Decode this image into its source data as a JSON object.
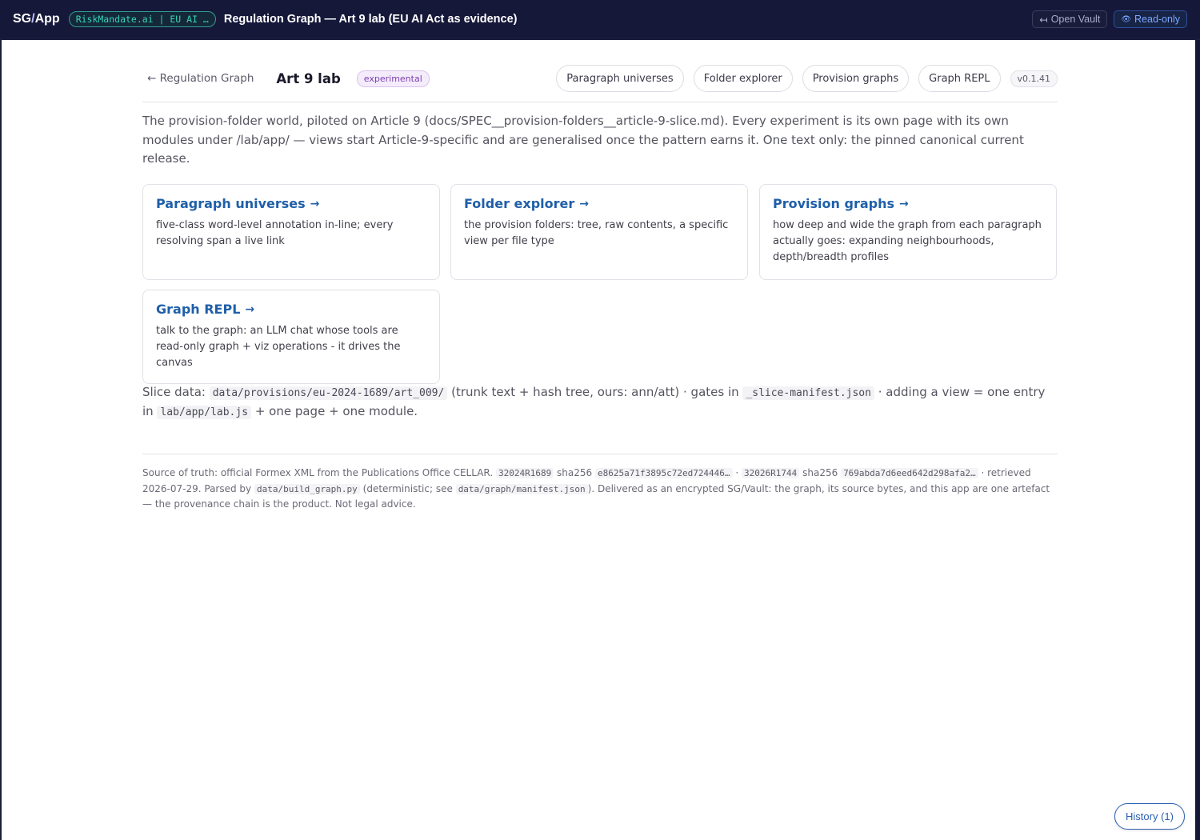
{
  "topbar": {
    "brand_prefix": "SG",
    "brand_slash": "/",
    "brand_suffix": "App",
    "tenant": "RiskMandate.ai | EU AI …",
    "window_title": "Regulation Graph — Art 9 lab (EU AI Act as evidence)",
    "open_vault_icon": "↤",
    "open_vault_label": "Open Vault",
    "read_only_icon": "👁",
    "read_only_label": "Read-only"
  },
  "header": {
    "back_arrow": "←",
    "back_label": "Regulation Graph",
    "title": "Art 9 lab",
    "badge": "experimental",
    "nav": [
      "Paragraph universes",
      "Folder explorer",
      "Provision graphs",
      "Graph REPL"
    ],
    "version": "v0.1.41"
  },
  "intro": "The provision-folder world, piloted on Article 9 (docs/SPEC__provision-folders__article-9-slice.md). Every experiment is its own page with its own modules under /lab/app/ — views start Article-9-specific and are generalised once the pattern earns it. One text only: the pinned canonical current release.",
  "cards": [
    {
      "title": "Paragraph universes",
      "arrow": "→",
      "desc": "five-class word-level annotation in-line; every resolving span a live link"
    },
    {
      "title": "Folder explorer",
      "arrow": "→",
      "desc": "the provision folders: tree, raw contents, a specific view per file type"
    },
    {
      "title": "Provision graphs",
      "arrow": "→",
      "desc": "how deep and wide the graph from each paragraph actually goes: expanding neighbourhoods, depth/breadth profiles"
    },
    {
      "title": "Graph REPL",
      "arrow": "→",
      "desc": "talk to the graph: an LLM chat whose tools are read-only graph + viz operations - it drives the canvas"
    }
  ],
  "slice": {
    "prefix": "Slice data:",
    "path": "data/provisions/eu-2024-1689/art_009/",
    "mid": "(trunk text + hash tree, ours: ann/att) · gates in",
    "manifest": "_slice-manifest.json",
    "mid2": "· adding a view = one entry in",
    "labjs": "lab/app/lab.js",
    "suffix": "+ one page + one module."
  },
  "footer": {
    "t1": "Source of truth: official Formex XML from the Publications Office CELLAR.",
    "c1": "32024R1689",
    "t2": "sha256",
    "c2": "e8625a71f3895c72ed724446…",
    "t3": "·",
    "c3": "32026R1744",
    "t4": "sha256",
    "c4": "769abda7d6eed642d298afa2…",
    "t5": "· retrieved 2026-07-29. Parsed by",
    "c5": "data/build_graph.py",
    "t6": "(deterministic; see",
    "c6": "data/graph/manifest.json",
    "t7": "). Delivered as an encrypted SG/Vault: the graph, its source bytes, and this app are one artefact — the provenance chain is the product. Not legal advice."
  },
  "history_label": "History (1)"
}
